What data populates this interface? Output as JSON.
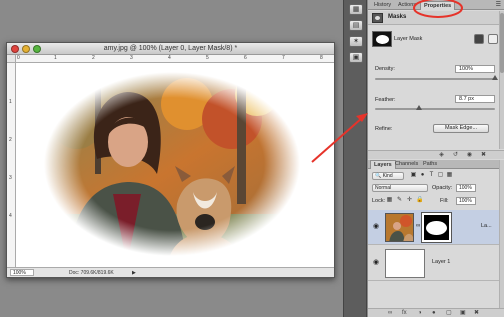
{
  "document": {
    "title": "amy.jpg @ 100% (Layer 0, Layer Mask/8) *",
    "zoom": "100%",
    "info": "Doc: 709.6K/819.6K",
    "status_arrow": "▶",
    "ruler_h_ticks": [
      "0",
      "1",
      "2",
      "3",
      "4",
      "5",
      "6",
      "7",
      "8"
    ],
    "ruler_v_ticks": [
      "1",
      "2",
      "3",
      "4"
    ]
  },
  "dock": {
    "buttons": [
      "▦",
      "▤",
      "✶",
      "▣"
    ]
  },
  "properties_panel": {
    "tabs": [
      "History",
      "Actions",
      "Properties"
    ],
    "active_tab": "Properties",
    "section": "Masks",
    "mask_type": "Layer Mask",
    "density": {
      "label": "Density:",
      "value": "100%",
      "level": 1.0
    },
    "feather": {
      "label": "Feather:",
      "value": "8.7 px",
      "level": 0.35
    },
    "refine": {
      "label": "Refine:",
      "button": "Mask Edge..."
    },
    "footer_icons": [
      "◈",
      "↺",
      "◉",
      "✖"
    ]
  },
  "layers_panel": {
    "tabs": [
      "Layers",
      "Channels",
      "Paths"
    ],
    "active_tab": "Layers",
    "kind_filter": "🔍 Kind",
    "blend_mode": "Normal",
    "opacity_label": "Opacity:",
    "opacity_value": "100%",
    "lock_label": "Lock:",
    "fill_label": "Fill:",
    "fill_value": "100%",
    "filter_icons": [
      "▣",
      "●",
      "T",
      "▢",
      "▦"
    ],
    "lock_icons": [
      "▦",
      "✎",
      "✛",
      "🔒"
    ],
    "layers": [
      {
        "name": "La...",
        "visible": true,
        "selected": true
      },
      {
        "name": "Layer 1",
        "visible": true,
        "selected": false
      }
    ],
    "footer_icons": [
      "∞",
      "fx",
      "◑",
      "●",
      "▢",
      "▣",
      "✖"
    ]
  },
  "colors": {
    "background": "#8a8a8a",
    "panel": "#d9d9d9",
    "highlight_ellipse": "#e6332a",
    "arrow": "#e6332a",
    "selection": "#c4cfe3"
  }
}
